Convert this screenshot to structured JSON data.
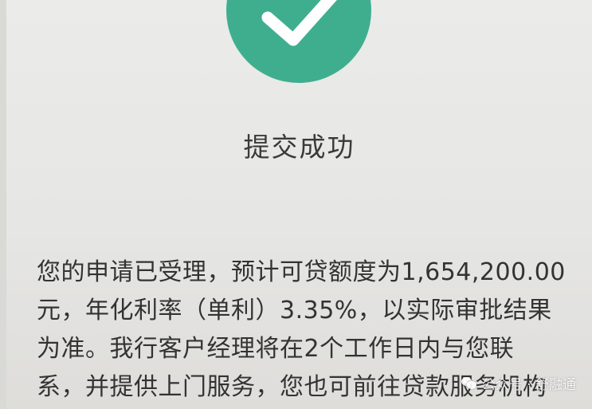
{
  "status": {
    "title": "提交成功",
    "success_color": "#3fae8f",
    "icon": "checkmark-icon"
  },
  "message": {
    "lines": [
      "您的申请已受理，预计可贷额度为1,654,200.00",
      "元，年化利率（单利）3.35%，以实际审批结果",
      "为准。我行客户经理将在2个工作日内与您联",
      "系，并提供上门服务，您也可前往贷款服务机构"
    ]
  },
  "watermark": {
    "text": "公众号 · 舒融通",
    "icon": "wechat-icon"
  }
}
